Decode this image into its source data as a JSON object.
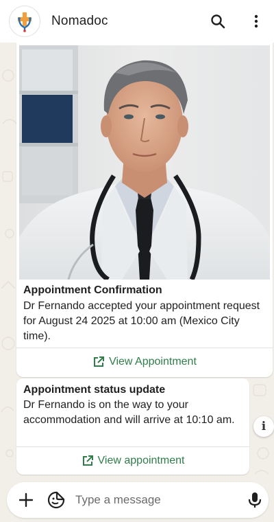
{
  "header": {
    "app_name": "Nomadoc",
    "logo_icon": "nomadoc-logo-icon",
    "search_icon": "search-icon",
    "menu_icon": "more-vert-icon"
  },
  "messages": [
    {
      "has_photo": true,
      "title": "Appointment Confirmation",
      "text": "Dr Fernando accepted your appointment request for August 24 2025 at 10:00 am (Mexico City time).",
      "link_label": "View Appointment",
      "link_icon": "open-external-icon"
    },
    {
      "title": "Appointment status update",
      "text": "Dr Fernando is on the way to your accommodation and will arrive at 10:10 am.",
      "link_label": "View appointment",
      "link_icon": "open-external-icon"
    }
  ],
  "info_button": {
    "label": "i"
  },
  "composer": {
    "placeholder": "Type a message",
    "value": "",
    "plus_icon": "plus-icon",
    "sticker_icon": "sticker-icon",
    "mic_icon": "mic-icon"
  },
  "colors": {
    "link_green": "#2f7d4a",
    "chat_background": "#f2efe9",
    "header_background": "#ffffff"
  }
}
